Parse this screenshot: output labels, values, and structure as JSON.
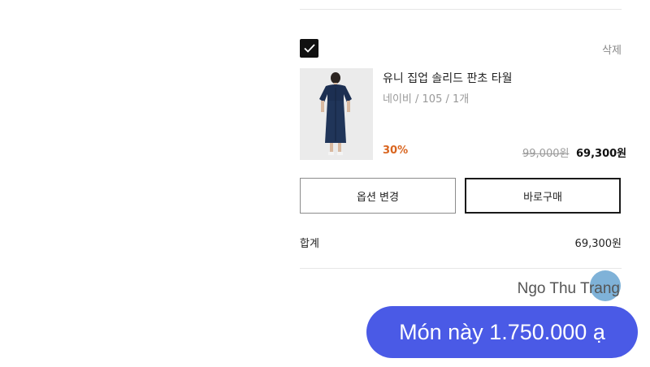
{
  "cart": {
    "item": {
      "selected": true,
      "delete_label": "삭제",
      "name": "유니 집업 솔리드 판초 타월",
      "option": "네이비 / 105 / 1개",
      "discount": "30%",
      "original_price": "99,000원",
      "final_price": "69,300원"
    },
    "buttons": {
      "change_option": "옵션 변경",
      "buy_now": "바로구매"
    },
    "total": {
      "label": "합계",
      "value": "69,300원"
    }
  },
  "chat": {
    "sender": "Ngo Thu Trang",
    "message": "Món này 1.750.000 ạ"
  },
  "colors": {
    "discount": "#d9651f",
    "bubble": "#4a5ae6",
    "fab": "#7fb2d8"
  }
}
